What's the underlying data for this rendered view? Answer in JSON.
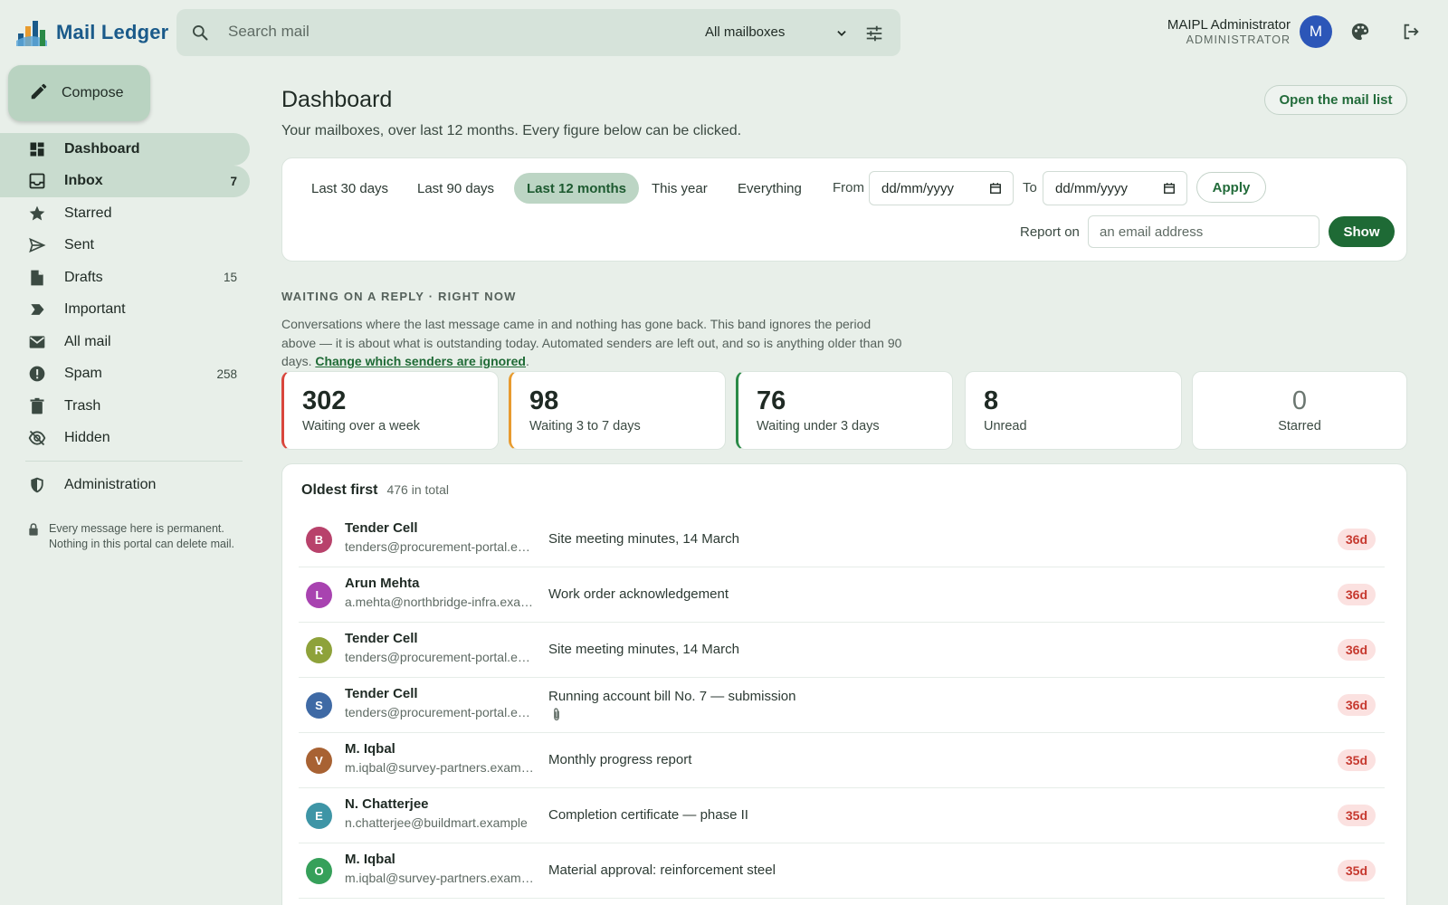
{
  "app": {
    "name": "Mail Ledger"
  },
  "search": {
    "placeholder": "Search mail",
    "mailbox": "All mailboxes"
  },
  "user": {
    "name": "MAIPL Administrator",
    "role": "ADMINISTRATOR",
    "initial": "M"
  },
  "compose": {
    "label": "Compose"
  },
  "nav": {
    "dashboard": {
      "label": "Dashboard"
    },
    "inbox": {
      "label": "Inbox",
      "count": "7"
    },
    "starred": {
      "label": "Starred"
    },
    "sent": {
      "label": "Sent"
    },
    "drafts": {
      "label": "Drafts",
      "count": "15"
    },
    "important": {
      "label": "Important"
    },
    "allmail": {
      "label": "All mail"
    },
    "spam": {
      "label": "Spam",
      "count": "258"
    },
    "trash": {
      "label": "Trash"
    },
    "hidden": {
      "label": "Hidden"
    },
    "administration": {
      "label": "Administration"
    }
  },
  "sidebar_note": "Every message here is permanent. Nothing in this portal can delete mail.",
  "page": {
    "title": "Dashboard",
    "subtitle": "Your mailboxes, over last 12 months. Every figure below can be clicked.",
    "open_list": "Open the mail list"
  },
  "filters": {
    "chips": [
      "Last 30 days",
      "Last 90 days",
      "Last 12 months",
      "This year",
      "Everything"
    ],
    "active_chip": "Last 12 months",
    "from_label": "From",
    "to_label": "To",
    "date_placeholder": "dd/mm/yyyy",
    "apply": "Apply",
    "report_label": "Report on",
    "report_placeholder": "an email address",
    "show": "Show"
  },
  "waiting": {
    "heading": "WAITING ON A REPLY · RIGHT NOW",
    "desc": "Conversations where the last message came in and nothing has gone back. This band ignores the period above — it is about what is outstanding today. Automated senders are left out, and so is anything older than 90 days.",
    "link": "Change which senders are ignored",
    "after_link": "."
  },
  "stats": [
    {
      "value": "302",
      "label": "Waiting over a week",
      "accent": "#d9463c"
    },
    {
      "value": "98",
      "label": "Waiting 3 to 7 days",
      "accent": "#e89b2f"
    },
    {
      "value": "76",
      "label": "Waiting under 3 days",
      "accent": "#2a8a47"
    },
    {
      "value": "8",
      "label": "Unread"
    },
    {
      "value": "0",
      "label": "Starred"
    }
  ],
  "list": {
    "title": "Oldest first",
    "total": "476 in total",
    "rows": [
      {
        "initial": "B",
        "color": "#b8426b",
        "name": "Tender Cell",
        "email": "tenders@procurement-portal.example",
        "subject": "Site meeting minutes, 14 March",
        "age": "36d"
      },
      {
        "initial": "L",
        "color": "#a843b0",
        "name": "Arun Mehta",
        "email": "a.mehta@northbridge-infra.example",
        "subject": "Work order acknowledgement",
        "age": "36d"
      },
      {
        "initial": "R",
        "color": "#8ea23a",
        "name": "Tender Cell",
        "email": "tenders@procurement-portal.example",
        "subject": "Site meeting minutes, 14 March",
        "age": "36d"
      },
      {
        "initial": "S",
        "color": "#3f6aa5",
        "name": "Tender Cell",
        "email": "tenders@procurement-portal.example",
        "subject": "Running account bill No. 7 — submission",
        "age": "36d",
        "attachment": true
      },
      {
        "initial": "V",
        "color": "#a86233",
        "name": "M. Iqbal",
        "email": "m.iqbal@survey-partners.example",
        "subject": "Monthly progress report",
        "age": "35d"
      },
      {
        "initial": "E",
        "color": "#3e95a6",
        "name": "N. Chatterjee",
        "email": "n.chatterjee@buildmart.example",
        "subject": "Completion certificate — phase II",
        "age": "35d"
      },
      {
        "initial": "O",
        "color": "#36a05a",
        "name": "M. Iqbal",
        "email": "m.iqbal@survey-partners.example",
        "subject": "Material approval: reinforcement steel",
        "age": "35d"
      }
    ]
  }
}
